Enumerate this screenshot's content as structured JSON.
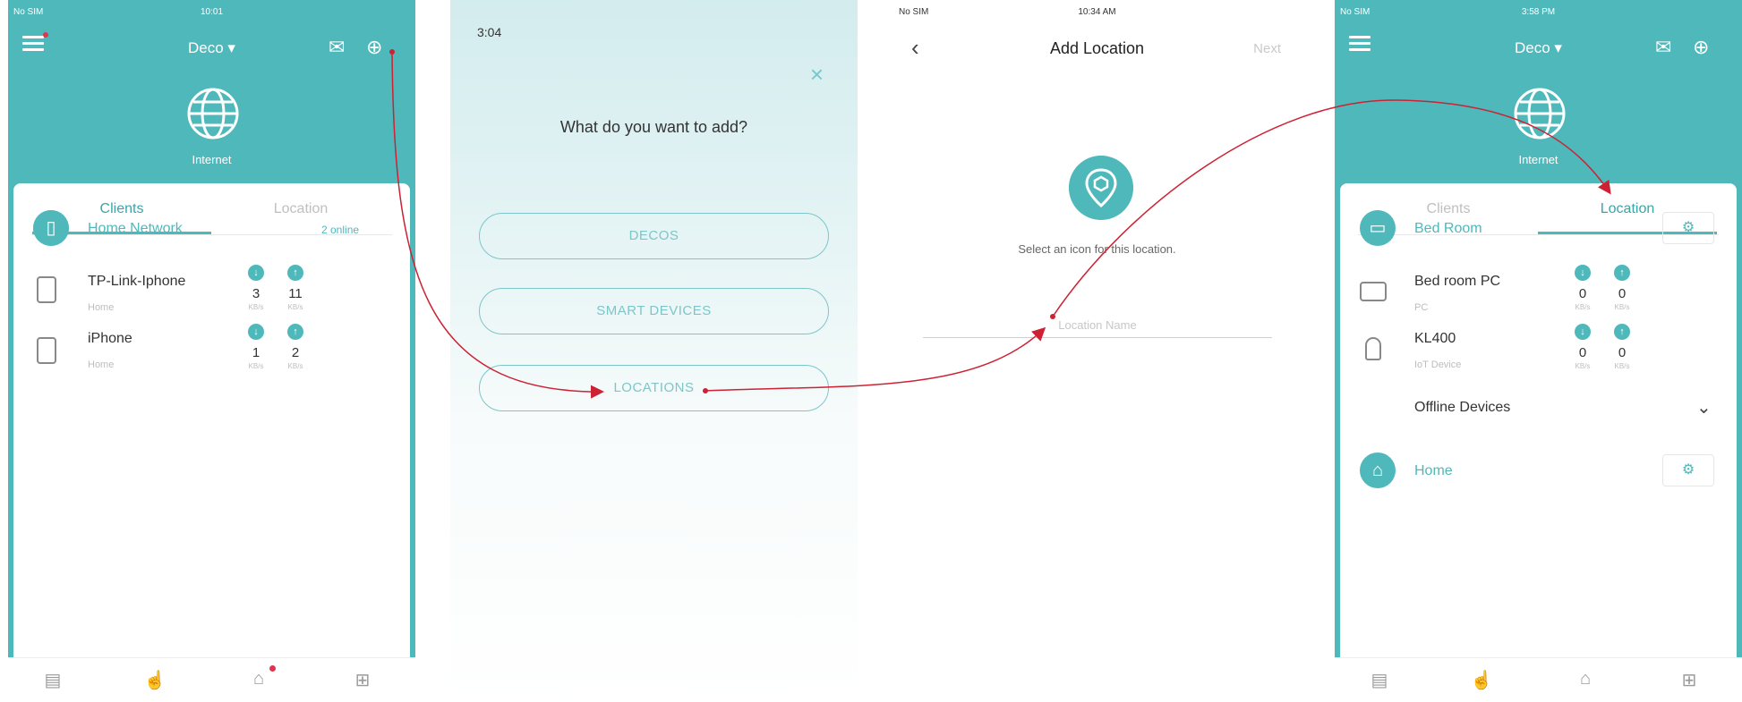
{
  "colors": {
    "teal": "#4fb8bb",
    "arrow": "#cc2233",
    "alert": "#e0354c"
  },
  "screen1": {
    "status": {
      "carrier": "No SIM",
      "time": "10:01",
      "battery": ""
    },
    "brand": "Deco ▾",
    "internet": "Internet",
    "tabs": {
      "clients": "Clients",
      "location": "Location"
    },
    "network": {
      "name": "Home Network",
      "count": "2 online"
    },
    "devices": [
      {
        "name": "TP-Link-Iphone",
        "location": "Home",
        "down": "3",
        "up": "11",
        "down_unit": "KB/s",
        "up_unit": "KB/s"
      },
      {
        "name": "iPhone",
        "location": "Home",
        "down": "1",
        "up": "2",
        "down_unit": "KB/s",
        "up_unit": "KB/s"
      }
    ],
    "icons": [
      "menu-icon",
      "mail-icon",
      "add-icon",
      "globe-icon",
      "phone-icon",
      "download-icon",
      "upload-icon",
      "overview-icon",
      "clients-icon",
      "shield-icon",
      "more-icon"
    ]
  },
  "screen2": {
    "status_time": "3:04",
    "title": "What do you want to add?",
    "options": [
      "DECOS",
      "SMART DEVICES",
      "LOCATIONS"
    ]
  },
  "screen3": {
    "status": {
      "carrier": "No SIM",
      "time": "10:34 AM",
      "battery": ""
    },
    "title": "Add Location",
    "next": "Next",
    "hint": "Select an icon for this location.",
    "placeholder": "Location Name"
  },
  "screen4": {
    "status": {
      "carrier": "No SIM",
      "time": "3:58 PM"
    },
    "brand": "Deco ▾",
    "internet": "Internet",
    "tabs": {
      "clients": "Clients",
      "location": "Location"
    },
    "group1": "Bed Room",
    "devices": [
      {
        "name": "Bed room PC",
        "type": "PC",
        "down": "0",
        "up": "0",
        "down_unit": "KB/s",
        "up_unit": "KB/s"
      },
      {
        "name": "KL400",
        "type": "IoT Device",
        "down": "0",
        "up": "0",
        "down_unit": "KB/s",
        "up_unit": "KB/s"
      }
    ],
    "offline": "Offline Devices",
    "group2": "Home"
  }
}
